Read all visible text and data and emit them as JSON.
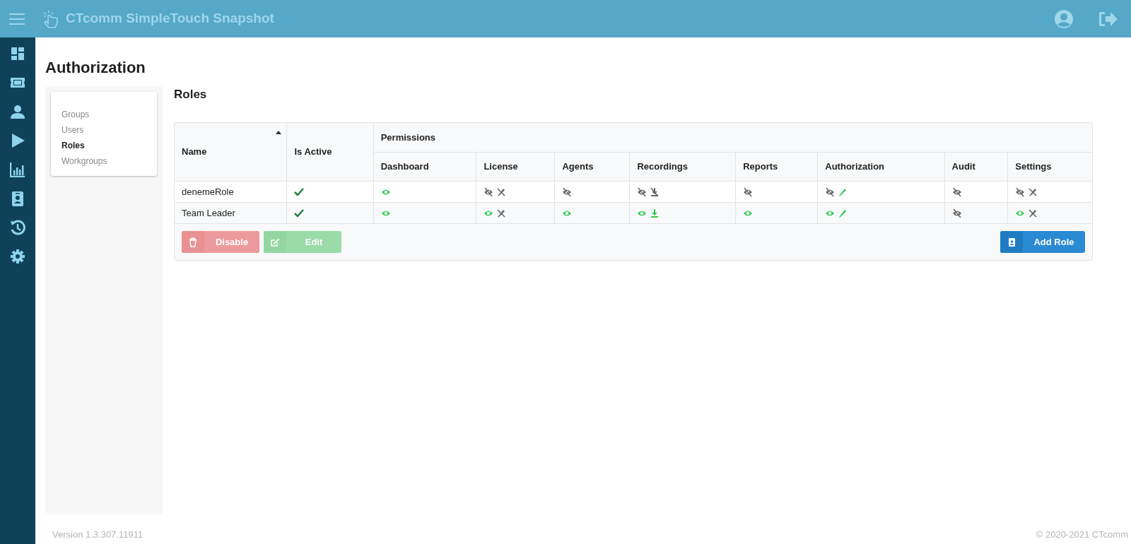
{
  "app": {
    "title": "CTcomm SimpleTouch Snapshot"
  },
  "nav_icons": [
    {
      "kind": "dashboard"
    },
    {
      "kind": "ticket"
    },
    {
      "kind": "user"
    },
    {
      "kind": "play"
    },
    {
      "kind": "chart"
    },
    {
      "kind": "badge"
    },
    {
      "kind": "history"
    },
    {
      "kind": "gear"
    }
  ],
  "page_title": "Authorization",
  "subnav": [
    {
      "label": "Groups",
      "selected": false
    },
    {
      "label": "Users",
      "selected": false
    },
    {
      "label": "Roles",
      "selected": true
    },
    {
      "label": "Workgroups",
      "selected": false
    }
  ],
  "section_title": "Roles",
  "table": {
    "name_header": "Name",
    "active_header": "Is Active",
    "group_header": "Permissions",
    "columns": [
      "Dashboard",
      "License",
      "Agents",
      "Recordings",
      "Reports",
      "Authorization",
      "Audit",
      "Settings"
    ],
    "rows": [
      {
        "name": "denemeRole",
        "active": true,
        "permissions": [
          [
            {
              "kind": "view",
              "granted": true
            }
          ],
          [
            {
              "kind": "view",
              "granted": false
            },
            {
              "kind": "edit",
              "granted": false
            }
          ],
          [
            {
              "kind": "view",
              "granted": false
            }
          ],
          [
            {
              "kind": "view",
              "granted": false
            },
            {
              "kind": "download",
              "granted": false
            }
          ],
          [
            {
              "kind": "view",
              "granted": false
            }
          ],
          [
            {
              "kind": "view",
              "granted": false
            },
            {
              "kind": "edit",
              "granted": true
            }
          ],
          [
            {
              "kind": "view",
              "granted": false
            }
          ],
          [
            {
              "kind": "view",
              "granted": false
            },
            {
              "kind": "edit",
              "granted": false
            }
          ]
        ]
      },
      {
        "name": "Team Leader",
        "active": true,
        "permissions": [
          [
            {
              "kind": "view",
              "granted": true
            }
          ],
          [
            {
              "kind": "view",
              "granted": true
            },
            {
              "kind": "edit",
              "granted": false
            }
          ],
          [
            {
              "kind": "view",
              "granted": true
            }
          ],
          [
            {
              "kind": "view",
              "granted": true
            },
            {
              "kind": "download",
              "granted": true
            }
          ],
          [
            {
              "kind": "view",
              "granted": true
            }
          ],
          [
            {
              "kind": "view",
              "granted": true
            },
            {
              "kind": "edit",
              "granted": true
            }
          ],
          [
            {
              "kind": "view",
              "granted": false
            }
          ],
          [
            {
              "kind": "view",
              "granted": true
            },
            {
              "kind": "edit",
              "granted": false
            }
          ]
        ]
      }
    ]
  },
  "buttons": [
    {
      "label": "Disable",
      "kind": "danger",
      "disabled": true
    },
    {
      "label": "Edit",
      "kind": "success",
      "disabled": true
    },
    {
      "label": "Add Role",
      "kind": "primary",
      "disabled": false
    }
  ],
  "footer": {
    "version": "Version 1.3.307.11911",
    "copyright": "© 2020-2021 CTcomm"
  }
}
